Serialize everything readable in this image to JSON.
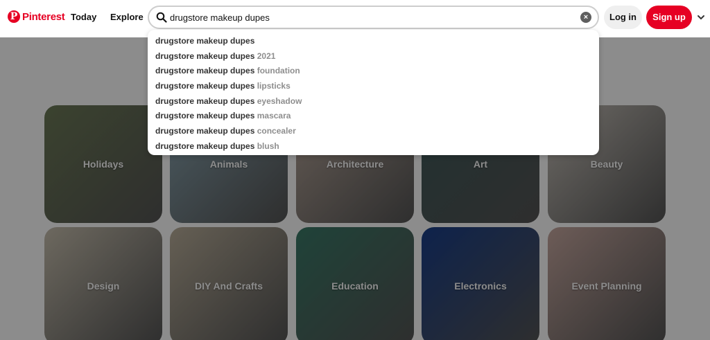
{
  "brand": {
    "name": "Pinterest",
    "accent": "#e60023"
  },
  "nav": {
    "today": "Today",
    "explore": "Explore"
  },
  "search": {
    "value": "drugstore makeup dupes",
    "icon": "search-icon",
    "clear_icon": "close-icon"
  },
  "buttons": {
    "login": "Log in",
    "signup": "Sign up"
  },
  "suggestions": [
    {
      "base": "drugstore makeup dupes",
      "extra": ""
    },
    {
      "base": "drugstore makeup dupes",
      "extra": "2021"
    },
    {
      "base": "drugstore makeup dupes",
      "extra": "foundation"
    },
    {
      "base": "drugstore makeup dupes",
      "extra": "lipsticks"
    },
    {
      "base": "drugstore makeup dupes",
      "extra": "eyeshadow"
    },
    {
      "base": "drugstore makeup dupes",
      "extra": "mascara"
    },
    {
      "base": "drugstore makeup dupes",
      "extra": "concealer"
    },
    {
      "base": "drugstore makeup dupes",
      "extra": "blush"
    }
  ],
  "categories": [
    {
      "label": "Holidays",
      "color": "#6c7a56"
    },
    {
      "label": "Animals",
      "color": "#8aa6b2"
    },
    {
      "label": "Architecture",
      "color": "#b7a69a"
    },
    {
      "label": "Art",
      "color": "#3e5a5a"
    },
    {
      "label": "Beauty",
      "color": "#c9c3bb"
    },
    {
      "label": "Design",
      "color": "#c7bfae"
    },
    {
      "label": "DIY And Crafts",
      "color": "#b9ae9a"
    },
    {
      "label": "Education",
      "color": "#3a7a68"
    },
    {
      "label": "Electronics",
      "color": "#1a3f8a"
    },
    {
      "label": "Event Planning",
      "color": "#c7a8a0"
    }
  ]
}
